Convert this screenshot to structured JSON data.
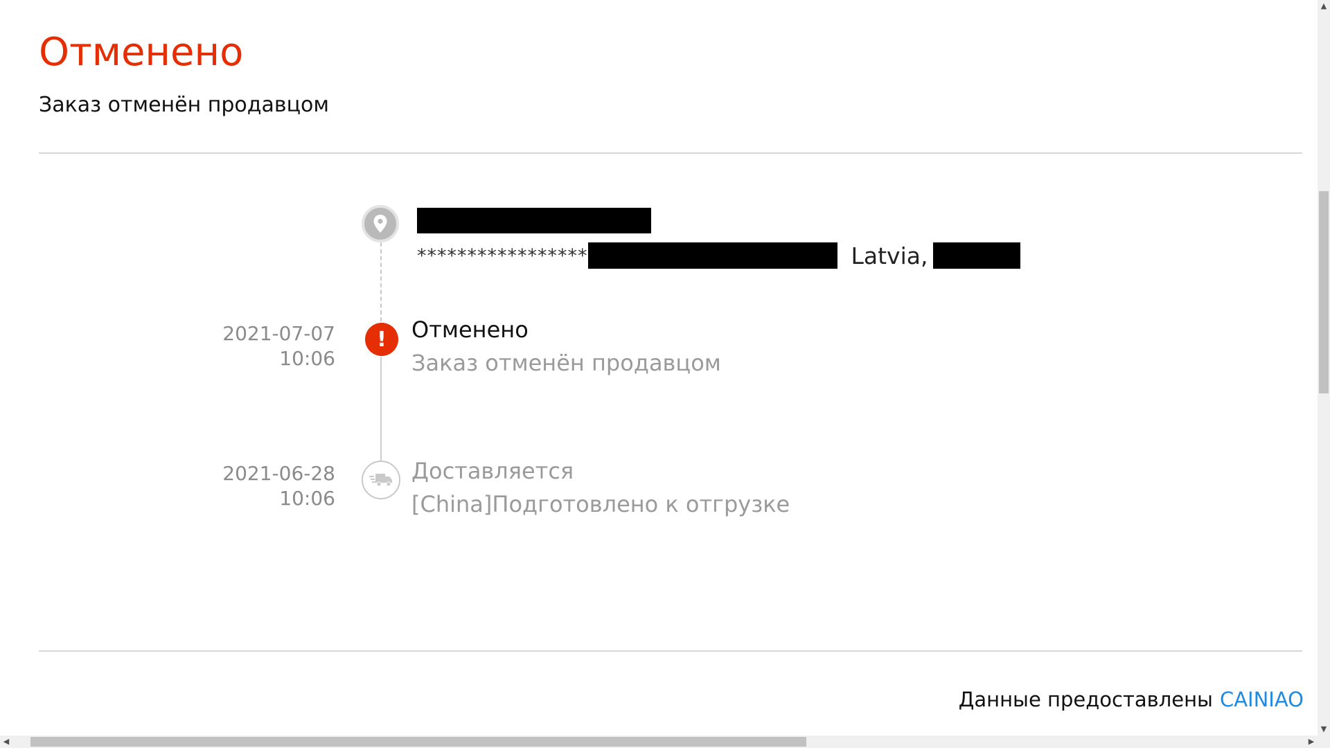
{
  "status": {
    "title": "Отменено",
    "subtitle": "Заказ отменён продавцом"
  },
  "address": {
    "masked": "*****************",
    "country": "Latvia,"
  },
  "timeline": [
    {
      "date": "2021-07-07 10:06",
      "title": "Отменено",
      "description": "Заказ отменён продавцом",
      "icon": "alert-icon"
    },
    {
      "date": "2021-06-28 10:06",
      "title": "Доставляется",
      "description": "[China]Подготовлено к отгрузке",
      "icon": "truck-icon"
    }
  ],
  "footer": {
    "provider_text": "Данные предоставлены",
    "provider_link": "CAINIAO"
  },
  "colors": {
    "accent": "#e62e04",
    "link": "#1f8ae0",
    "muted": "#9a9a9a"
  }
}
